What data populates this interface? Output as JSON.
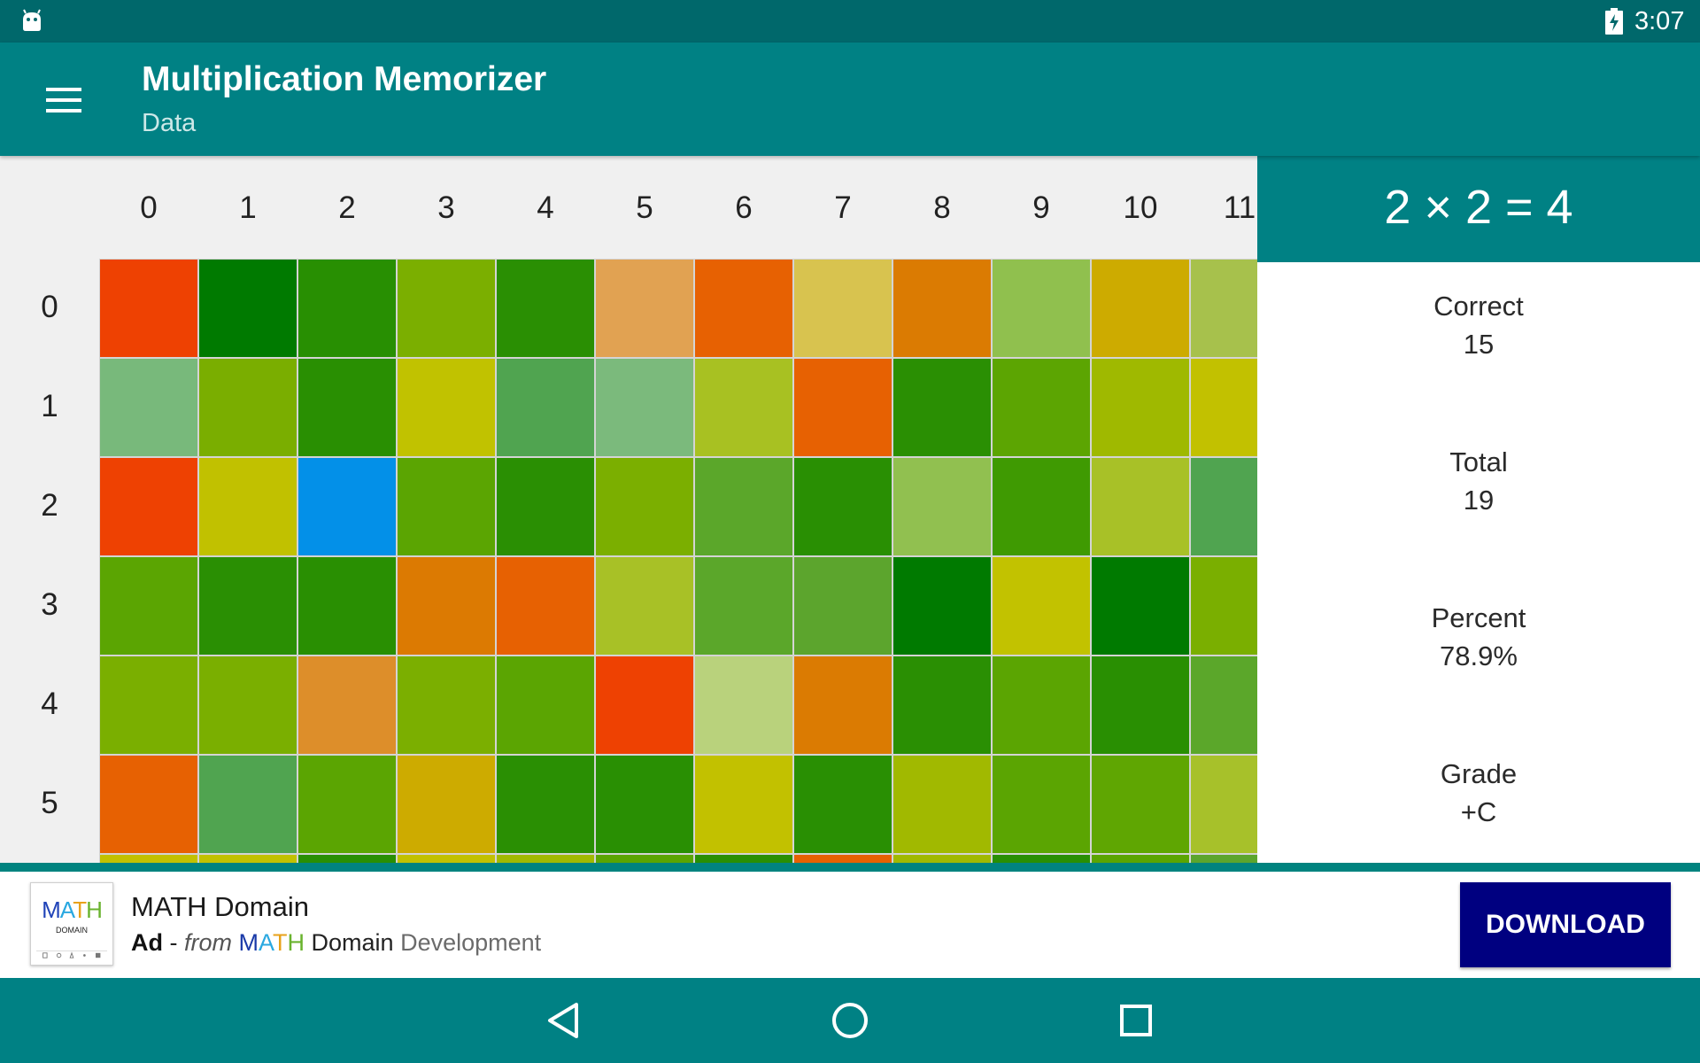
{
  "status_bar": {
    "time": "3:07",
    "left_icon": "android-debug-icon",
    "right_icon": "battery-charging-icon"
  },
  "app_bar": {
    "title": "Multiplication Memorizer",
    "subtitle": "Data",
    "menu_icon": "hamburger-menu-icon"
  },
  "grid": {
    "columns": [
      "0",
      "1",
      "2",
      "3",
      "4",
      "5",
      "6",
      "7",
      "8",
      "9",
      "10",
      "11"
    ],
    "rows": [
      "0",
      "1",
      "2",
      "3",
      "4",
      "5"
    ],
    "cell_colors": [
      [
        "#ee4102",
        "#007a00",
        "#288f02",
        "#7baf00",
        "#2a8f03",
        "#e1a252",
        "#e76102",
        "#d8c34f",
        "#db7b02",
        "#90c04e",
        "#cdab00",
        "#a7c14c"
      ],
      [
        "#78b97b",
        "#7aae00",
        "#298f02",
        "#c1c200",
        "#50a450",
        "#7bba7c",
        "#a8c122",
        "#e76102",
        "#2a8f03",
        "#5ca502",
        "#9fb900",
        "#c2c100"
      ],
      [
        "#ee4102",
        "#c1c100",
        "#0390e8",
        "#5ba502",
        "#2a8f03",
        "#7baf00",
        "#5ba72a",
        "#298f03",
        "#91c050",
        "#3f9a02",
        "#a8c127",
        "#50a450"
      ],
      [
        "#5ba502",
        "#2a8f03",
        "#298f02",
        "#dc7a02",
        "#e76102",
        "#a8c126",
        "#5ba72a",
        "#5ca52d",
        "#007a00",
        "#c2c200",
        "#007a00",
        "#7aaf00"
      ],
      [
        "#7aaf00",
        "#7aaf00",
        "#dd8e2a",
        "#7baf00",
        "#5ba502",
        "#ee4102",
        "#b9d27c",
        "#db7b02",
        "#2a8f03",
        "#5ba502",
        "#298f02",
        "#5ba72a"
      ],
      [
        "#e76102",
        "#50a450",
        "#5ba502",
        "#cdab00",
        "#2a8f03",
        "#298f03",
        "#c2c100",
        "#298f03",
        "#a1b900",
        "#5ba502",
        "#5fa602",
        "#a7c12a"
      ]
    ],
    "partial_row_colors": [
      "#c2c100",
      "#c2c100",
      "#298f03",
      "#c2c100",
      "#a1b900",
      "#5ba502",
      "#298f03",
      "#e76102",
      "#a1b900",
      "#298f03",
      "#5ba502",
      "#5ca52d"
    ],
    "background": "#f0f0f0",
    "gap_color": "#d4d4d4"
  },
  "side_panel": {
    "equation": "2 × 2 = 4",
    "stats": [
      {
        "label": "Correct",
        "value": "15"
      },
      {
        "label": "Total",
        "value": "19"
      },
      {
        "label": "Percent",
        "value": "78.9%"
      },
      {
        "label": "Grade",
        "value": "+C"
      }
    ]
  },
  "ad": {
    "logo_word_parts": [
      {
        "text": "M",
        "color": "#2043b8"
      },
      {
        "text": "A",
        "color": "#2aa8e0"
      },
      {
        "text": "T",
        "color": "#e8a21a"
      },
      {
        "text": "H",
        "color": "#6ab32e"
      }
    ],
    "logo_sub": "DOMAIN",
    "title": "MATH Domain",
    "label": "Ad",
    "separator": " - ",
    "from": "from",
    "brand_parts": [
      {
        "text": "M",
        "color": "#1a3aa8"
      },
      {
        "text": "A",
        "color": "#2aa8e0"
      },
      {
        "text": "T",
        "color": "#e8a21a"
      },
      {
        "text": "H",
        "color": "#6ab32e"
      }
    ],
    "brand_rest": " Domain",
    "developer": " Development",
    "button_label": "DOWNLOAD"
  },
  "nav_bar": {
    "back_icon": "back-triangle-icon",
    "home_icon": "home-circle-icon",
    "recents_icon": "recents-square-icon"
  },
  "colors": {
    "status_bar": "#00686b",
    "primary": "#008184",
    "ad_button": "#000080"
  }
}
